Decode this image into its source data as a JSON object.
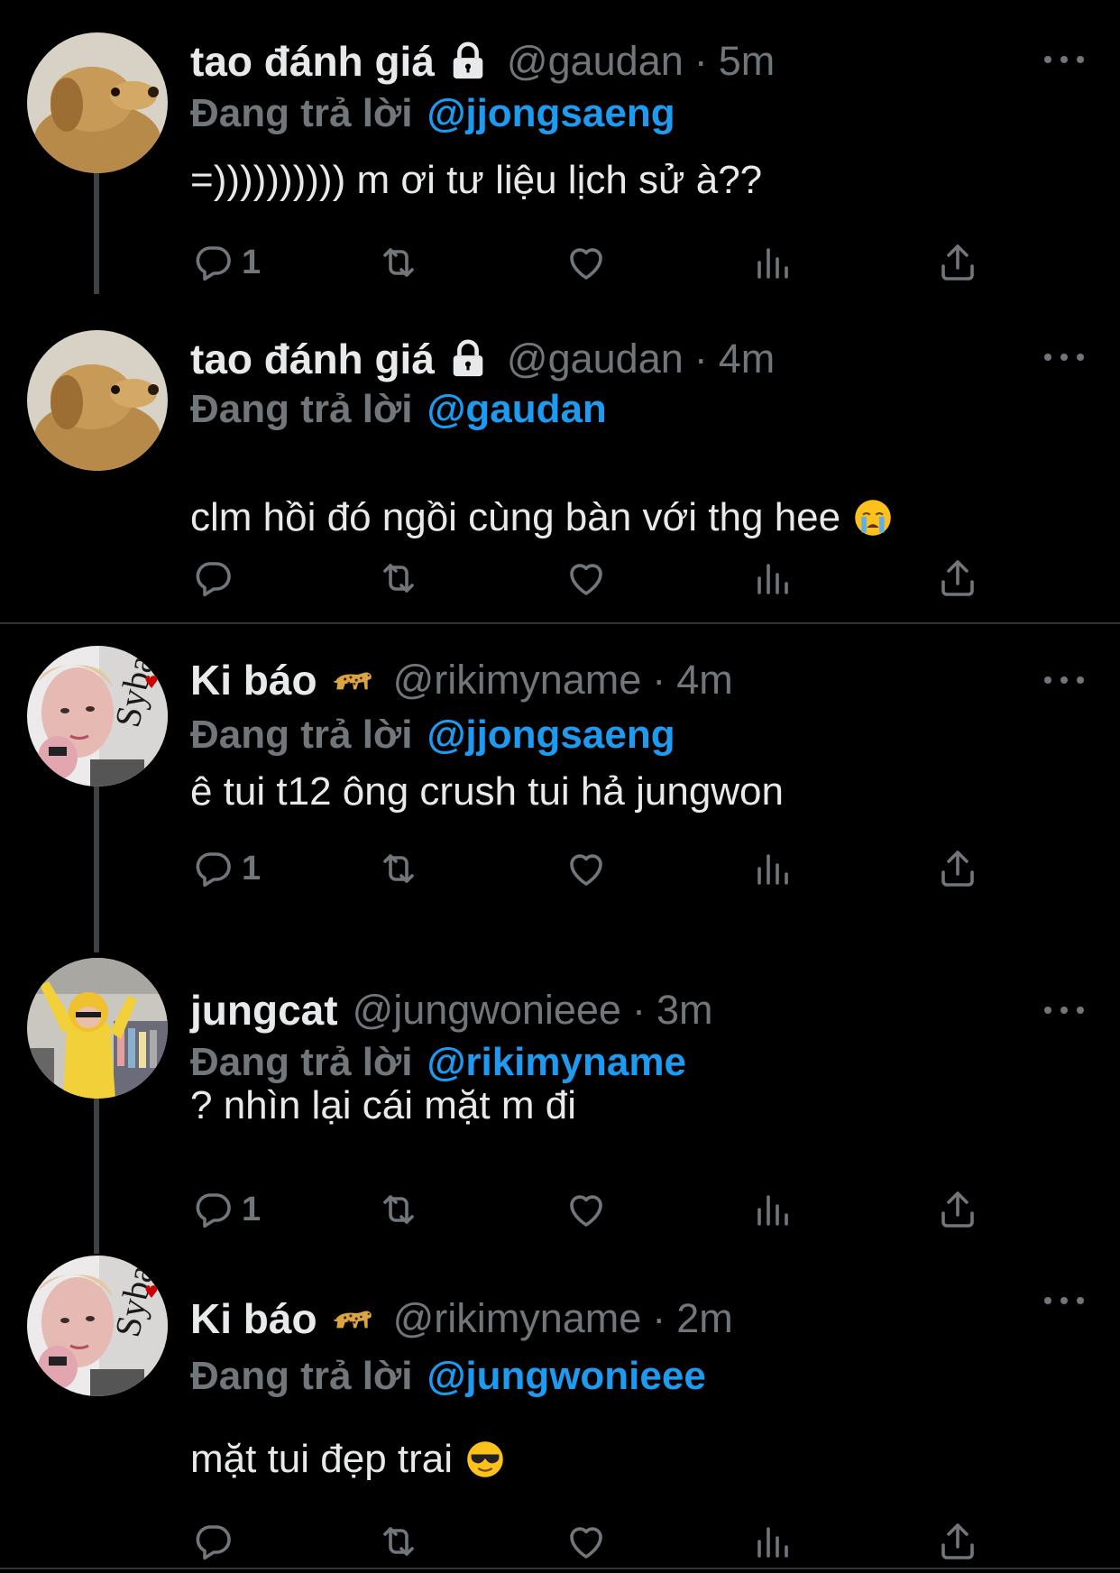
{
  "reply_prefix": "Đang trả lời",
  "tweets": [
    {
      "name": "tao đánh giá",
      "handle": "@gaudan",
      "time": "5m",
      "reply_to": "@jjongsaeng",
      "text": "=)))))))))) m ơi tư liệu lịch sử à??",
      "reply_count": "1"
    },
    {
      "name": "tao đánh giá",
      "handle": "@gaudan",
      "time": "4m",
      "reply_to": "@gaudan",
      "text": "clm hồi đó ngồi cùng bàn với thg hee",
      "reply_count": ""
    },
    {
      "name": "Ki báo",
      "handle": "@rikimyname",
      "time": "4m",
      "reply_to": "@jjongsaeng",
      "text": "ê tui t12 ông crush tui hả jungwon",
      "reply_count": "1"
    },
    {
      "name": "jungcat",
      "handle": "@jungwonieee",
      "time": "3m",
      "reply_to": "@rikimyname",
      "text": "? nhìn lại cái mặt m đi",
      "reply_count": "1"
    },
    {
      "name": "Ki báo",
      "handle": "@rikimyname",
      "time": "2m",
      "reply_to": "@jungwonieee",
      "text": "mặt tui đẹp trai",
      "reply_count": ""
    }
  ],
  "colors": {
    "background": "#000000",
    "primary_text": "#e7e9ea",
    "secondary_text": "#71767b",
    "link": "#1d9bf0",
    "divider": "#2f3336"
  },
  "icons": {
    "lock": "lock-icon",
    "leopard": "leopard-emoji-icon",
    "crying": "loudly-crying-face-icon",
    "cool": "sunglasses-face-icon",
    "reply": "reply-icon",
    "retweet": "retweet-icon",
    "like": "heart-icon",
    "views": "views-icon",
    "share": "share-icon",
    "more": "more-icon"
  }
}
